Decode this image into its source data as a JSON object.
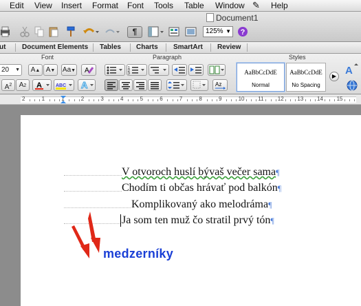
{
  "menu": [
    "Edit",
    "View",
    "Insert",
    "Format",
    "Font",
    "Tools",
    "Table",
    "Window",
    "Help"
  ],
  "window_title": "Document1",
  "toolbar": {
    "zoom": "125%",
    "paragraph_mark": "¶"
  },
  "ribbon_tabs": [
    "ut",
    "Document Elements",
    "Tables",
    "Charts",
    "SmartArt",
    "Review"
  ],
  "ribbon": {
    "font_group_label": "Font",
    "font_size": "20",
    "paragraph_group_label": "Paragraph",
    "styles_group_label": "Styles",
    "style_preview_text": "AaBbCcDdE",
    "style_normal": "Normal",
    "style_no_spacing": "No Spacing"
  },
  "ruler": {
    "numbers": [
      "2",
      "1",
      "1",
      "2",
      "3",
      "4",
      "5",
      "6",
      "7",
      "8",
      "9",
      "10",
      "11",
      "12",
      "13",
      "14",
      "15"
    ]
  },
  "document": {
    "lines": [
      "V otvoroch huslí bývaš večer sama",
      "Chodím ti občas hrávať pod balkón",
      "Komplikovaný ako melodráma",
      "Ja som ten muž čo stratil prvý tón"
    ],
    "pilcrow": "¶"
  },
  "callout": "medzerníky",
  "colors": {
    "accent_blue": "#1a3fd6",
    "arrow_red": "#e02818",
    "pilcrow": "#4f7fd9"
  }
}
